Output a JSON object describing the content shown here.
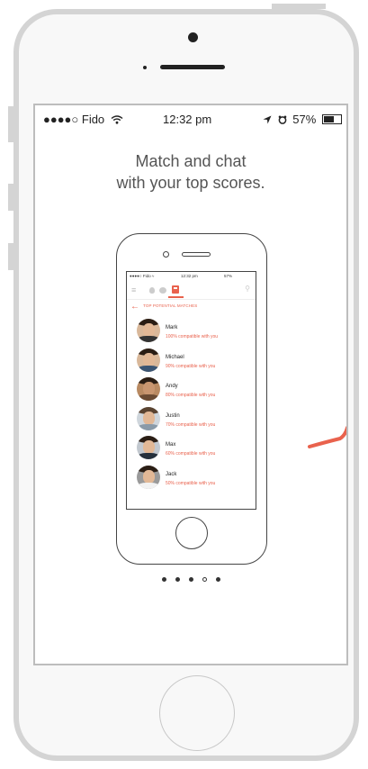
{
  "status_bar": {
    "carrier": "●●●●○ Fido",
    "time": "12:32 pm",
    "right": "57%"
  },
  "headline": {
    "line1": "Match and chat",
    "line2": "with your top scores."
  },
  "mini_app": {
    "status_left": "●●●●○ Fido ≈",
    "status_time": "12:32 pm",
    "status_right": "57%",
    "section_title": "TOP POTENTIAL MATCHES",
    "matches": [
      {
        "name": "Mark",
        "compat": "100% compatible with you"
      },
      {
        "name": "Michael",
        "compat": "90% compatible with you"
      },
      {
        "name": "Andy",
        "compat": "80% compatible with you"
      },
      {
        "name": "Justin",
        "compat": "70% compatible with you"
      },
      {
        "name": "Max",
        "compat": "60% compatible with you"
      },
      {
        "name": "Jack",
        "compat": "50% compatible with you"
      }
    ]
  },
  "pagination": {
    "total": 5,
    "current_index": 3
  },
  "colors": {
    "accent": "#e9624d",
    "frame": "#d4d4d4"
  }
}
